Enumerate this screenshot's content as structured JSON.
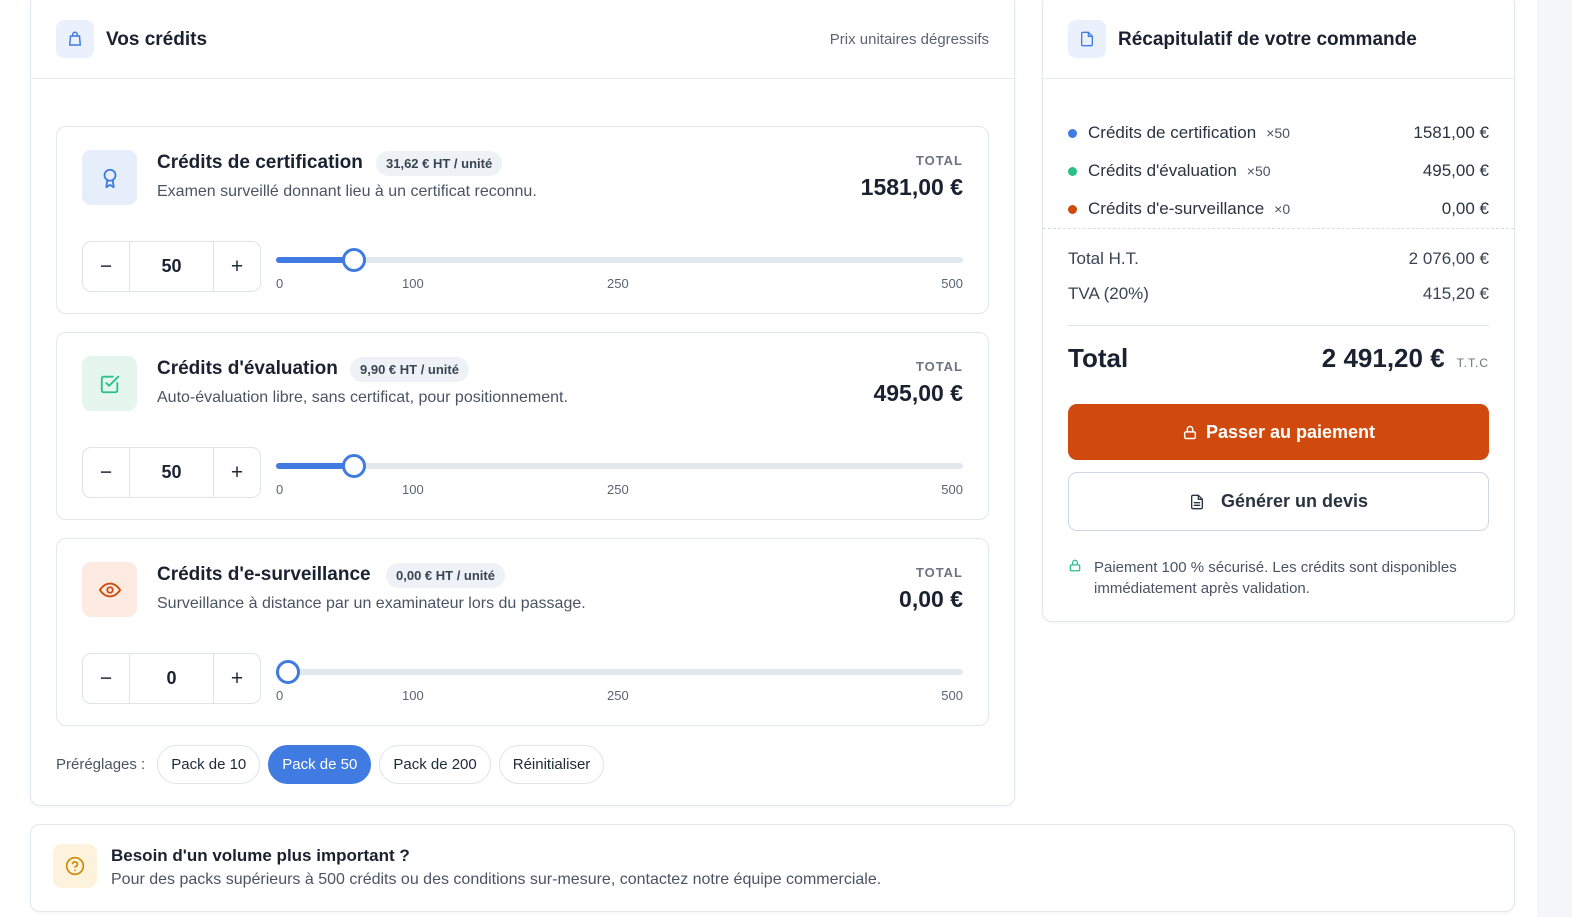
{
  "credits_card": {
    "title": "Vos crédits",
    "note": "Prix unitaires dégressifs",
    "total_label": "TOTAL",
    "slider_ticks": [
      "0",
      "100",
      "250",
      "500"
    ],
    "slider_max": 500,
    "items": [
      {
        "title": "Crédits de certification",
        "unit_price": "31,62 € HT / unité",
        "description": "Examen surveillé donnant lieu à un certificat reconnu.",
        "total": "1581,00 €",
        "quantity": "50",
        "quantity_value": 50,
        "icon": "award-icon",
        "accent": "#3f7be0",
        "icon_bg": "#e6eefc"
      },
      {
        "title": "Crédits d'évaluation",
        "unit_price": "9,90 € HT / unité",
        "description": "Auto-évaluation libre, sans certificat, pour positionnement.",
        "total": "495,00 €",
        "quantity": "50",
        "quantity_value": 50,
        "icon": "check-square-icon",
        "accent": "#2bbf8a",
        "icon_bg": "#e4f6ee"
      },
      {
        "title": "Crédits d'e-surveillance",
        "unit_price": "0,00 € HT / unité",
        "description": "Surveillance à distance par un examinateur lors du passage.",
        "total": "0,00 €",
        "quantity": "0",
        "quantity_value": 0,
        "icon": "eye-icon",
        "accent": "#cf4a0c",
        "icon_bg": "#fdebe1"
      }
    ],
    "stepper": {
      "minus": "−",
      "plus": "+"
    },
    "presets": {
      "label": "Préréglages :",
      "options": [
        "Pack de 10",
        "Pack de 50",
        "Pack de 200",
        "Réinitialiser"
      ],
      "active_index": 1
    }
  },
  "summary": {
    "title": "Récapitulatif de votre commande",
    "lines": [
      {
        "label": "Crédits de certification",
        "qty": "×50",
        "amount": "1581,00 €",
        "color": "#3f7be0"
      },
      {
        "label": "Crédits d'évaluation",
        "qty": "×50",
        "amount": "495,00 €",
        "color": "#2bbf8a"
      },
      {
        "label": "Crédits d'e-surveillance",
        "qty": "×0",
        "amount": "0,00 €",
        "color": "#cf4a0c"
      }
    ],
    "total_ht_label": "Total H.T.",
    "total_ht": "2 076,00 €",
    "tva_label": "TVA (20%)",
    "tva": "415,20 €",
    "total_label": "Total",
    "total": "2 491,20 €",
    "ttc": "T.T.C",
    "pay_button": "Passer au paiement",
    "quote_button": "Générer un devis",
    "secure_note": "Paiement 100 % sécurisé. Les crédits sont disponibles immédiatement après validation."
  },
  "help": {
    "title": "Besoin d'un volume plus important ?",
    "text": "Pour des packs supérieurs à 500 crédits ou des conditions sur-mesure, contactez notre équipe commerciale."
  },
  "colors": {
    "primary": "#3f7be0",
    "pay": "#cf4a0c",
    "success": "#2bbf8a"
  }
}
